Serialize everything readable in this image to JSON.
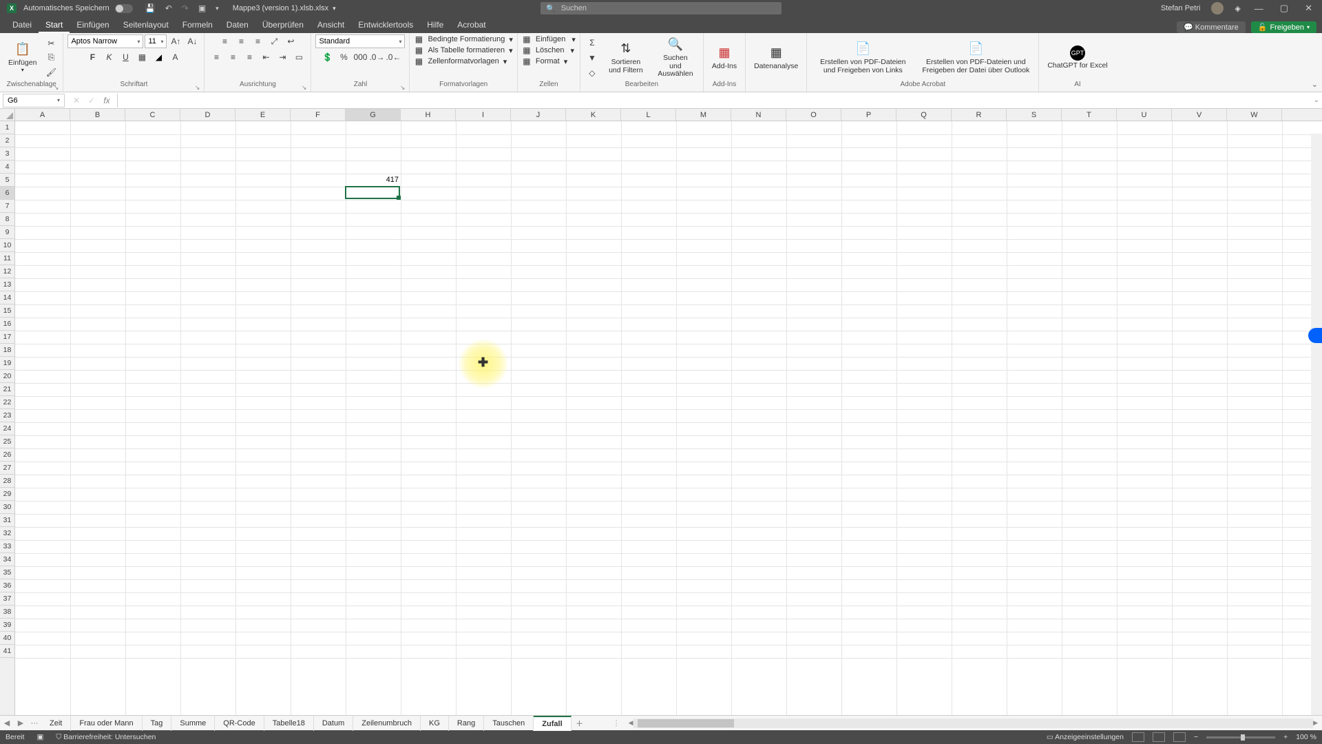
{
  "titlebar": {
    "autosave_label": "Automatisches Speichern",
    "doc_name": "Mappe3 (version 1).xlsb.xlsx",
    "search_placeholder": "Suchen",
    "user_name": "Stefan Petri"
  },
  "menu": {
    "tabs": [
      "Datei",
      "Start",
      "Einfügen",
      "Seitenlayout",
      "Formeln",
      "Daten",
      "Überprüfen",
      "Ansicht",
      "Entwicklertools",
      "Hilfe",
      "Acrobat"
    ],
    "active_index": 1,
    "comments": "Kommentare",
    "share": "Freigeben"
  },
  "ribbon": {
    "clipboard": {
      "paste": "Einfügen",
      "label": "Zwischenablage"
    },
    "font": {
      "name": "Aptos Narrow",
      "size": "11",
      "bold": "F",
      "italic": "K",
      "underline": "U",
      "label": "Schriftart"
    },
    "alignment": {
      "label": "Ausrichtung"
    },
    "number": {
      "format": "Standard",
      "label": "Zahl"
    },
    "styles": {
      "conditional": "Bedingte Formatierung",
      "as_table": "Als Tabelle formatieren",
      "cell_styles": "Zellenformatvorlagen",
      "label": "Formatvorlagen"
    },
    "cells": {
      "insert": "Einfügen",
      "delete": "Löschen",
      "format": "Format",
      "label": "Zellen"
    },
    "editing": {
      "sort": "Sortieren und Filtern",
      "find": "Suchen und Auswählen",
      "label": "Bearbeiten"
    },
    "addins": {
      "btn": "Add-Ins",
      "label": "Add-Ins"
    },
    "analysis": {
      "btn": "Datenanalyse"
    },
    "acrobat": {
      "create_links": "Erstellen von PDF-Dateien und Freigeben von Links",
      "create_outlook": "Erstellen von PDF-Dateien und Freigeben der Datei über Outlook",
      "label": "Adobe Acrobat"
    },
    "ai": {
      "btn": "ChatGPT for Excel",
      "label": "AI"
    }
  },
  "namebox": {
    "value": "G6"
  },
  "formula": {
    "value": ""
  },
  "grid": {
    "columns": [
      "A",
      "B",
      "C",
      "D",
      "E",
      "F",
      "G",
      "H",
      "I",
      "J",
      "K",
      "L",
      "M",
      "N",
      "O",
      "P",
      "Q",
      "R",
      "S",
      "T",
      "U",
      "V",
      "W"
    ],
    "active_col_index": 6,
    "row_count": 41,
    "active_row": 6,
    "cells": {
      "G5": "417"
    },
    "selection": {
      "col": 6,
      "row": 5
    },
    "highlight": {
      "col": 8,
      "row": 18
    }
  },
  "sheets": {
    "tabs": [
      "Zeit",
      "Frau oder Mann",
      "Tag",
      "Summe",
      "QR-Code",
      "Tabelle18",
      "Datum",
      "Zeilenumbruch",
      "KG",
      "Rang",
      "Tauschen",
      "Zufall"
    ],
    "active_index": 11
  },
  "statusbar": {
    "ready": "Bereit",
    "accessibility": "Barrierefreiheit: Untersuchen",
    "display_settings": "Anzeigeeinstellungen",
    "zoom": "100 %"
  }
}
